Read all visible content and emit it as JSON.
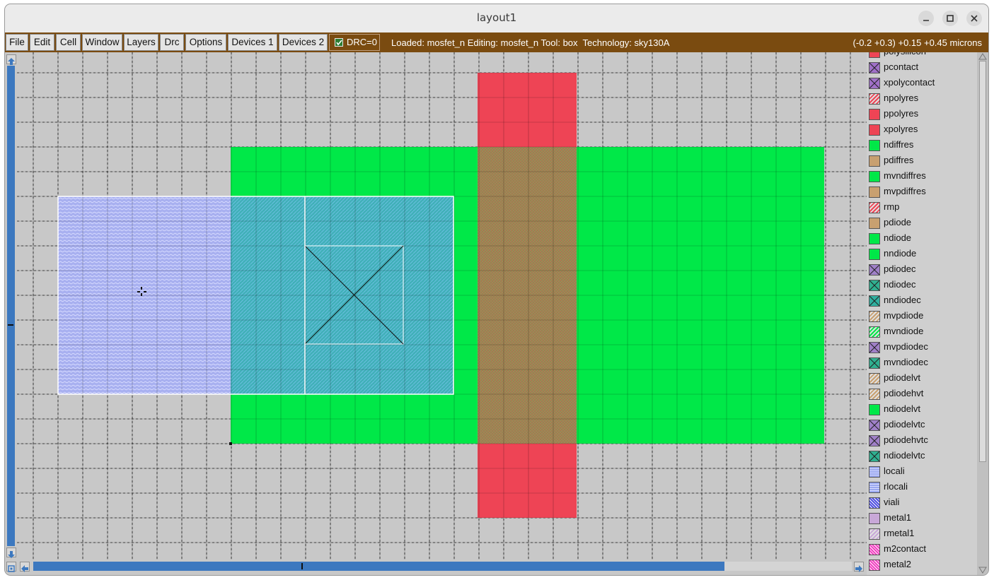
{
  "window": {
    "title": "layout1"
  },
  "menu": [
    "File",
    "Edit",
    "Cell",
    "Window",
    "Layers",
    "Drc",
    "Options",
    "Devices 1",
    "Devices 2"
  ],
  "drc": {
    "label": "DRC=0",
    "checked": true
  },
  "status": {
    "text": "Loaded: mosfet_n Editing: mosfet_n Tool: box  Technology: sky130A",
    "coords": "(-0.2 +0.3) +0.15 +0.45 microns"
  },
  "layers": [
    {
      "name": "polysilicon",
      "color": "#ee4455",
      "pattern": "solid"
    },
    {
      "name": "pcontact",
      "color": "#a070c8",
      "pattern": "cross"
    },
    {
      "name": "xpolycontact",
      "color": "#a070c8",
      "pattern": "cross"
    },
    {
      "name": "npolyres",
      "color": "#ee4455",
      "pattern": "hatch"
    },
    {
      "name": "ppolyres",
      "color": "#ee4455",
      "pattern": "solid"
    },
    {
      "name": "xpolyres",
      "color": "#ee4455",
      "pattern": "solid"
    },
    {
      "name": "ndiffres",
      "color": "#00e848",
      "pattern": "solid"
    },
    {
      "name": "pdiffres",
      "color": "#c8a070",
      "pattern": "solid"
    },
    {
      "name": "mvndiffres",
      "color": "#00e848",
      "pattern": "solid"
    },
    {
      "name": "mvpdiffres",
      "color": "#c8a070",
      "pattern": "solid"
    },
    {
      "name": "rmp",
      "color": "#ee4455",
      "pattern": "hatch"
    },
    {
      "name": "pdiode",
      "color": "#c8a070",
      "pattern": "solid"
    },
    {
      "name": "ndiode",
      "color": "#00e848",
      "pattern": "solid"
    },
    {
      "name": "nndiode",
      "color": "#00e848",
      "pattern": "solid"
    },
    {
      "name": "pdiodec",
      "color": "#a080c8",
      "pattern": "cross"
    },
    {
      "name": "ndiodec",
      "color": "#30b090",
      "pattern": "cross"
    },
    {
      "name": "nndiodec",
      "color": "#30b0a0",
      "pattern": "cross"
    },
    {
      "name": "mvpdiode",
      "color": "#c8a070",
      "pattern": "hatch"
    },
    {
      "name": "mvndiode",
      "color": "#00e848",
      "pattern": "hatch"
    },
    {
      "name": "mvpdiodec",
      "color": "#a080c8",
      "pattern": "cross"
    },
    {
      "name": "mvndiodec",
      "color": "#30b090",
      "pattern": "cross"
    },
    {
      "name": "pdiodelvt",
      "color": "#c8a070",
      "pattern": "hatch"
    },
    {
      "name": "pdiodehvt",
      "color": "#c8a070",
      "pattern": "hatch"
    },
    {
      "name": "ndiodelvt",
      "color": "#00e848",
      "pattern": "solid"
    },
    {
      "name": "pdiodelvtc",
      "color": "#a080c8",
      "pattern": "cross"
    },
    {
      "name": "pdiodehvtc",
      "color": "#a080c8",
      "pattern": "cross"
    },
    {
      "name": "ndiodelvtc",
      "color": "#30b090",
      "pattern": "cross"
    },
    {
      "name": "locali",
      "color": "#9aa8f0",
      "pattern": "wave"
    },
    {
      "name": "rlocali",
      "color": "#9aa8f0",
      "pattern": "wave"
    },
    {
      "name": "viali",
      "color": "#5050e0",
      "pattern": "checker"
    },
    {
      "name": "metal1",
      "color": "#c8a8d8",
      "pattern": "solid"
    },
    {
      "name": "rmetal1",
      "color": "#c8a8d8",
      "pattern": "hatch"
    },
    {
      "name": "m2contact",
      "color": "#f040c0",
      "pattern": "checker"
    },
    {
      "name": "metal2",
      "color": "#f040c0",
      "pattern": "checker"
    }
  ],
  "colors": {
    "menubar": "#7a4b10",
    "canvas": "#c8c8c8",
    "poly": "#ee4455",
    "diff": "#00e848",
    "overlap": "#a08858",
    "locali": "#a8b0f0",
    "licon": "#40b0b8",
    "scrollbar": "#3c78bf"
  }
}
